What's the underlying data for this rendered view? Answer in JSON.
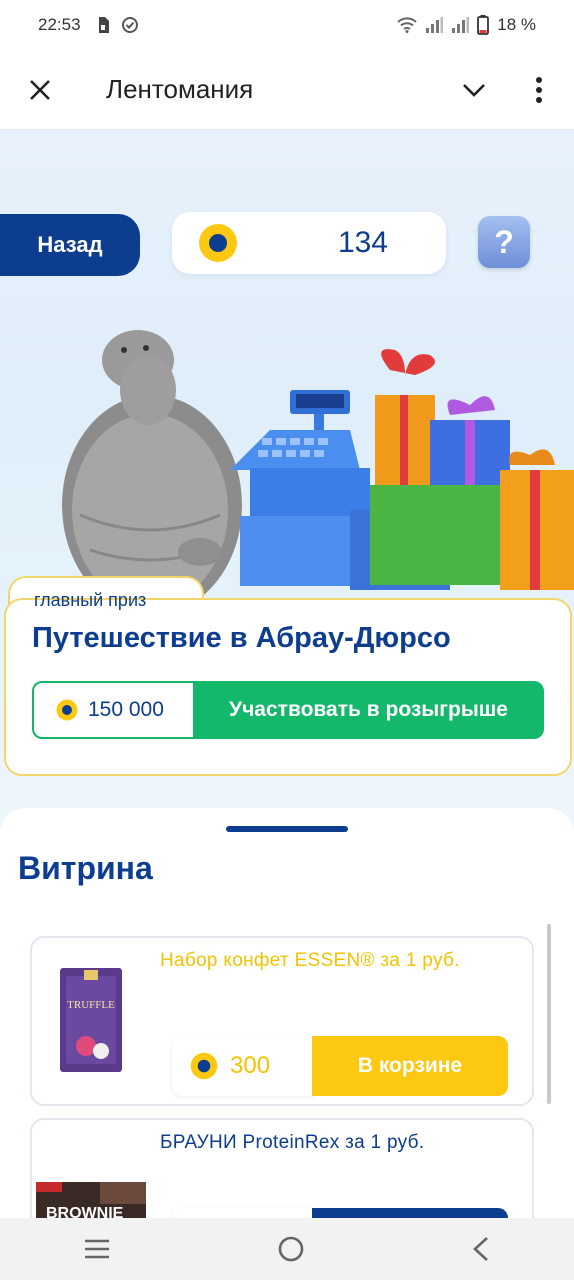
{
  "status_bar": {
    "time": "22:53",
    "battery": "18 %"
  },
  "header": {
    "title": "Лентомания"
  },
  "top": {
    "back_label": "Назад",
    "balance": "134",
    "help_label": "?"
  },
  "prize": {
    "label": "главный приз",
    "title": "Путешествие в Абрау-Дюрсо",
    "price": "150 000",
    "button": "Участвовать в розыгрыше"
  },
  "showcase": {
    "title": "Витрина",
    "products": [
      {
        "name": "Набор конфет ESSEN® за 1 руб.",
        "price": "300",
        "action": "В корзине",
        "image_text": "TRUFFLE",
        "status": "in-cart"
      },
      {
        "name": "БРАУНИ ProteinRex за 1 руб.",
        "price": "",
        "action": "",
        "image_text": "BROWNIE",
        "status": "available"
      }
    ]
  },
  "colors": {
    "brand": "#0d3d8e",
    "green": "#13b86a",
    "yellow": "#fdc811",
    "yellow_text": "#f2c300",
    "card_border": "#f3d56a"
  }
}
